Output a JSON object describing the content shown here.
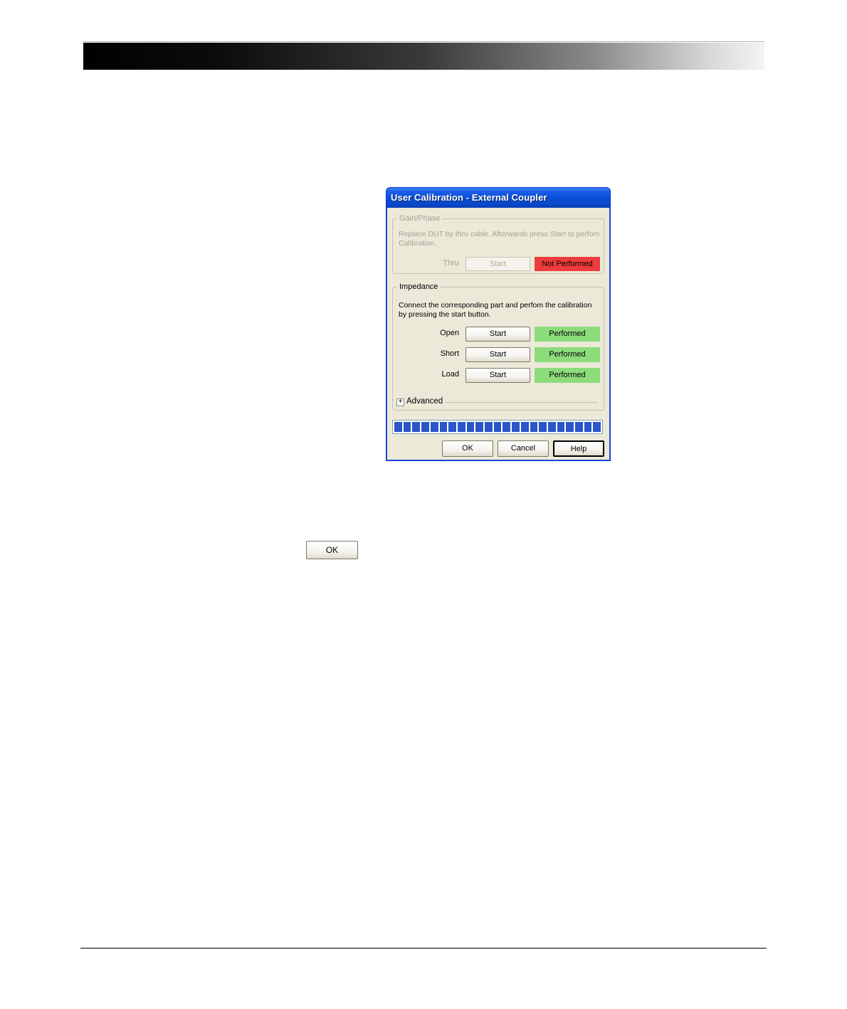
{
  "dialog": {
    "title": "User Calibration - External Coupler",
    "gain_phase": {
      "legend": "Gain/Phase",
      "description": "Replace DUT by thru cable. Afterwards press Start to perfom Calibration.",
      "rows": [
        {
          "label": "Thru",
          "button": "Start",
          "status": "Not Performed",
          "status_color": "#ee3c3c"
        }
      ]
    },
    "impedance": {
      "legend": "Impedance",
      "description": "Connect the corresponding part and perfom the calibration by pressing the start button.",
      "rows": [
        {
          "label": "Open",
          "button": "Start",
          "status": "Performed",
          "status_color": "#8cdc7c"
        },
        {
          "label": "Short",
          "button": "Start",
          "status": "Performed",
          "status_color": "#8cdc7c"
        },
        {
          "label": "Load",
          "button": "Start",
          "status": "Performed",
          "status_color": "#8cdc7c"
        }
      ],
      "advanced_label": "Advanced"
    },
    "progress": 1.0,
    "buttons": {
      "ok": "OK",
      "cancel": "Cancel",
      "help": "Help"
    }
  },
  "inline_button": {
    "label": "OK"
  },
  "colors": {
    "titlebar": "#0b4fd8",
    "dialog_bg": "#ece9d8",
    "progress_fill": "#2b55c8"
  }
}
